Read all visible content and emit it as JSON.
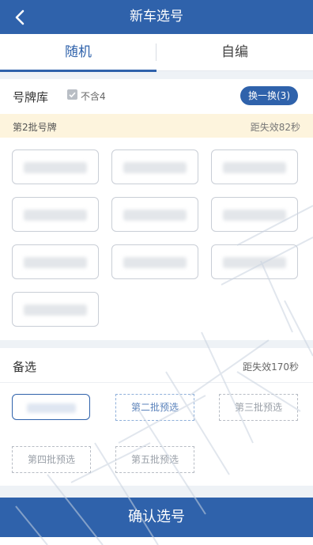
{
  "header": {
    "title": "新车选号",
    "back_icon": "chevron-left-icon"
  },
  "tabs": [
    {
      "label": "随机",
      "active": true
    },
    {
      "label": "自编",
      "active": false
    }
  ],
  "pool": {
    "title": "号牌库",
    "exclude_four_label": "不含4",
    "exclude_four_checked": true,
    "swap_button": "换一换(3)",
    "batch_name": "第2批号牌",
    "batch_countdown": "距失效82秒",
    "plates_count_visible": 10
  },
  "backup": {
    "title": "备选",
    "countdown": "距失效170秒",
    "slots": [
      {
        "label": "",
        "state": "selected"
      },
      {
        "label": "第二批预选",
        "state": "accent"
      },
      {
        "label": "第三批预选",
        "state": "empty"
      },
      {
        "label": "第四批预选",
        "state": "empty"
      },
      {
        "label": "第五批预选",
        "state": "empty"
      }
    ]
  },
  "confirm_button": "确认选号",
  "colors": {
    "primary": "#2f62ab",
    "batch_bg": "#fdf4dd"
  }
}
